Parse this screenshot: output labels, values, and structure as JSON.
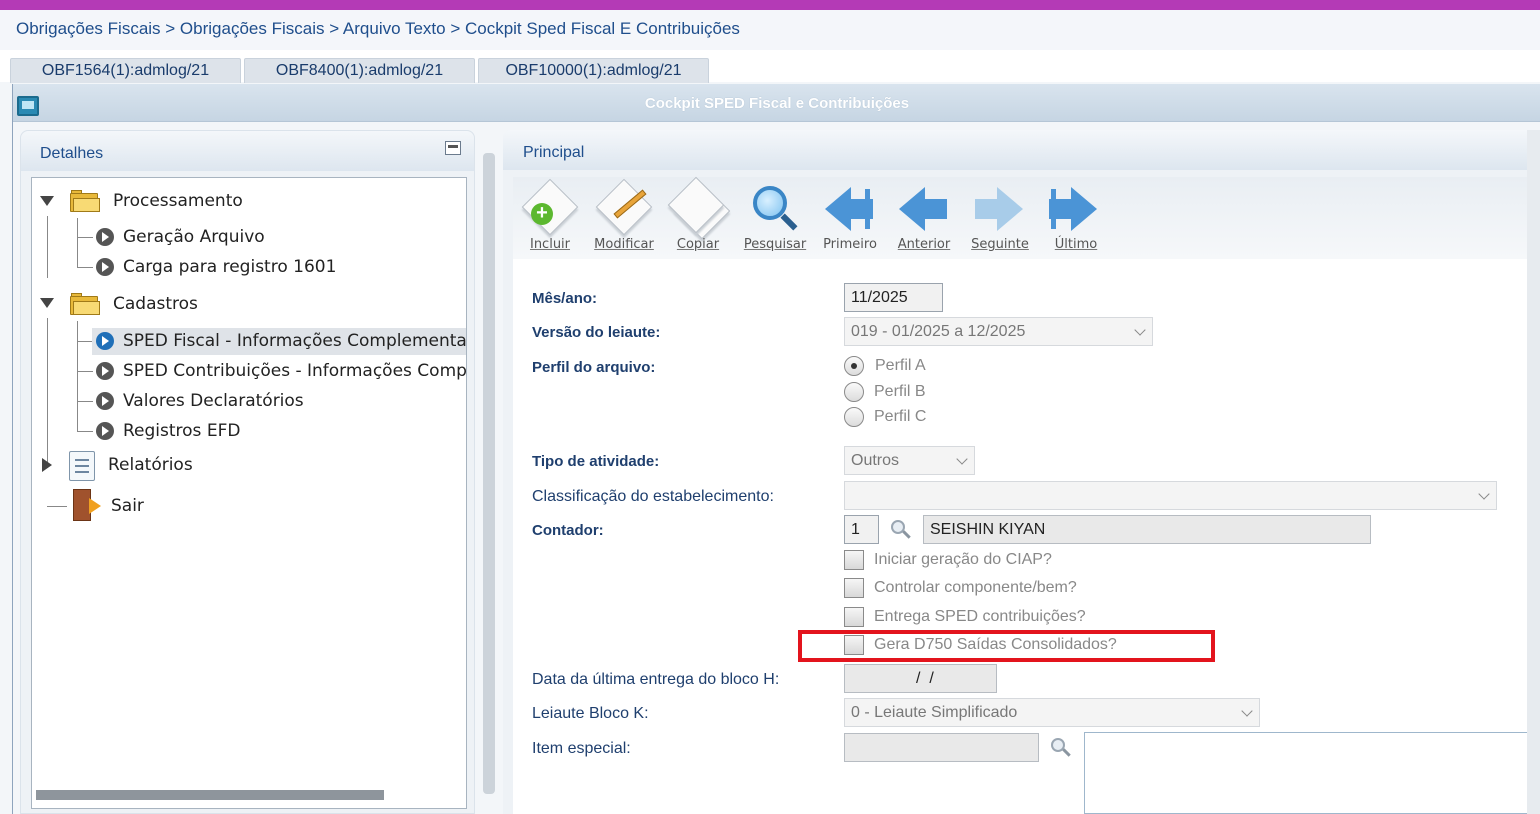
{
  "breadcrumb": "Obrigações Fiscais > Obrigações Fiscais > Arquivo Texto > Cockpit Sped Fiscal E Contribuições",
  "tabs": [
    "OBF1564(1):admlog/21",
    "OBF8400(1):admlog/21",
    "OBF10000(1):admlog/21"
  ],
  "window_title": "Cockpit SPED Fiscal e Contribuições",
  "left_panel": {
    "title": "Detalhes",
    "tree": {
      "processamento": "Processamento",
      "geracao": "Geração Arquivo",
      "carga": "Carga para registro 1601",
      "cadastros": "Cadastros",
      "sped_fiscal": "SPED Fiscal - Informações Complementares",
      "sped_contrib": "SPED Contribuições - Informações Complementares",
      "valores": "Valores Declaratórios",
      "registros": "Registros EFD",
      "relatorios": "Relatórios",
      "sair": "Sair"
    }
  },
  "right_panel": {
    "title": "Principal",
    "toolbar": {
      "incluir": "Incluir",
      "modificar": "Modificar",
      "copiar": "Copiar",
      "pesquisar": "Pesquisar",
      "primeiro": "Primeiro",
      "anterior": "Anterior",
      "seguinte": "Seguinte",
      "ultimo": "Último"
    },
    "form": {
      "mes_ano_label": "Mês/ano:",
      "mes_ano_value": "11/2025",
      "versao_label": "Versão do leiaute:",
      "versao_value": "019 - 01/2025 a 12/2025",
      "perfil_label": "Perfil do arquivo:",
      "perfil_a": "Perfil A",
      "perfil_b": "Perfil B",
      "perfil_c": "Perfil C",
      "perfil_selected": "Perfil A",
      "tipo_label": "Tipo de atividade:",
      "tipo_value": "Outros",
      "classif_label": "Classificação do estabelecimento:",
      "classif_value": "",
      "contador_label": "Contador:",
      "contador_code": "1",
      "contador_name": "SEISHIN KIYAN",
      "ciap": "Iniciar geração do CIAP?",
      "componente": "Controlar componente/bem?",
      "entrega_sped": "Entrega SPED contribuições?",
      "gera_d750": "Gera D750 Saídas Consolidados?",
      "data_bloco_h_label": "Data da última entrega do bloco H:",
      "data_bloco_h_value": "  /  /",
      "leiaute_k_label": "Leiaute Bloco K:",
      "leiaute_k_value": "0 - Leiaute Simplificado",
      "item_especial_label": "Item especial:",
      "item_especial_value": ""
    }
  },
  "colors": {
    "accent_top": "#b43ab6",
    "highlight_box": "#e3141d",
    "link_blue": "#1f4e8c"
  }
}
